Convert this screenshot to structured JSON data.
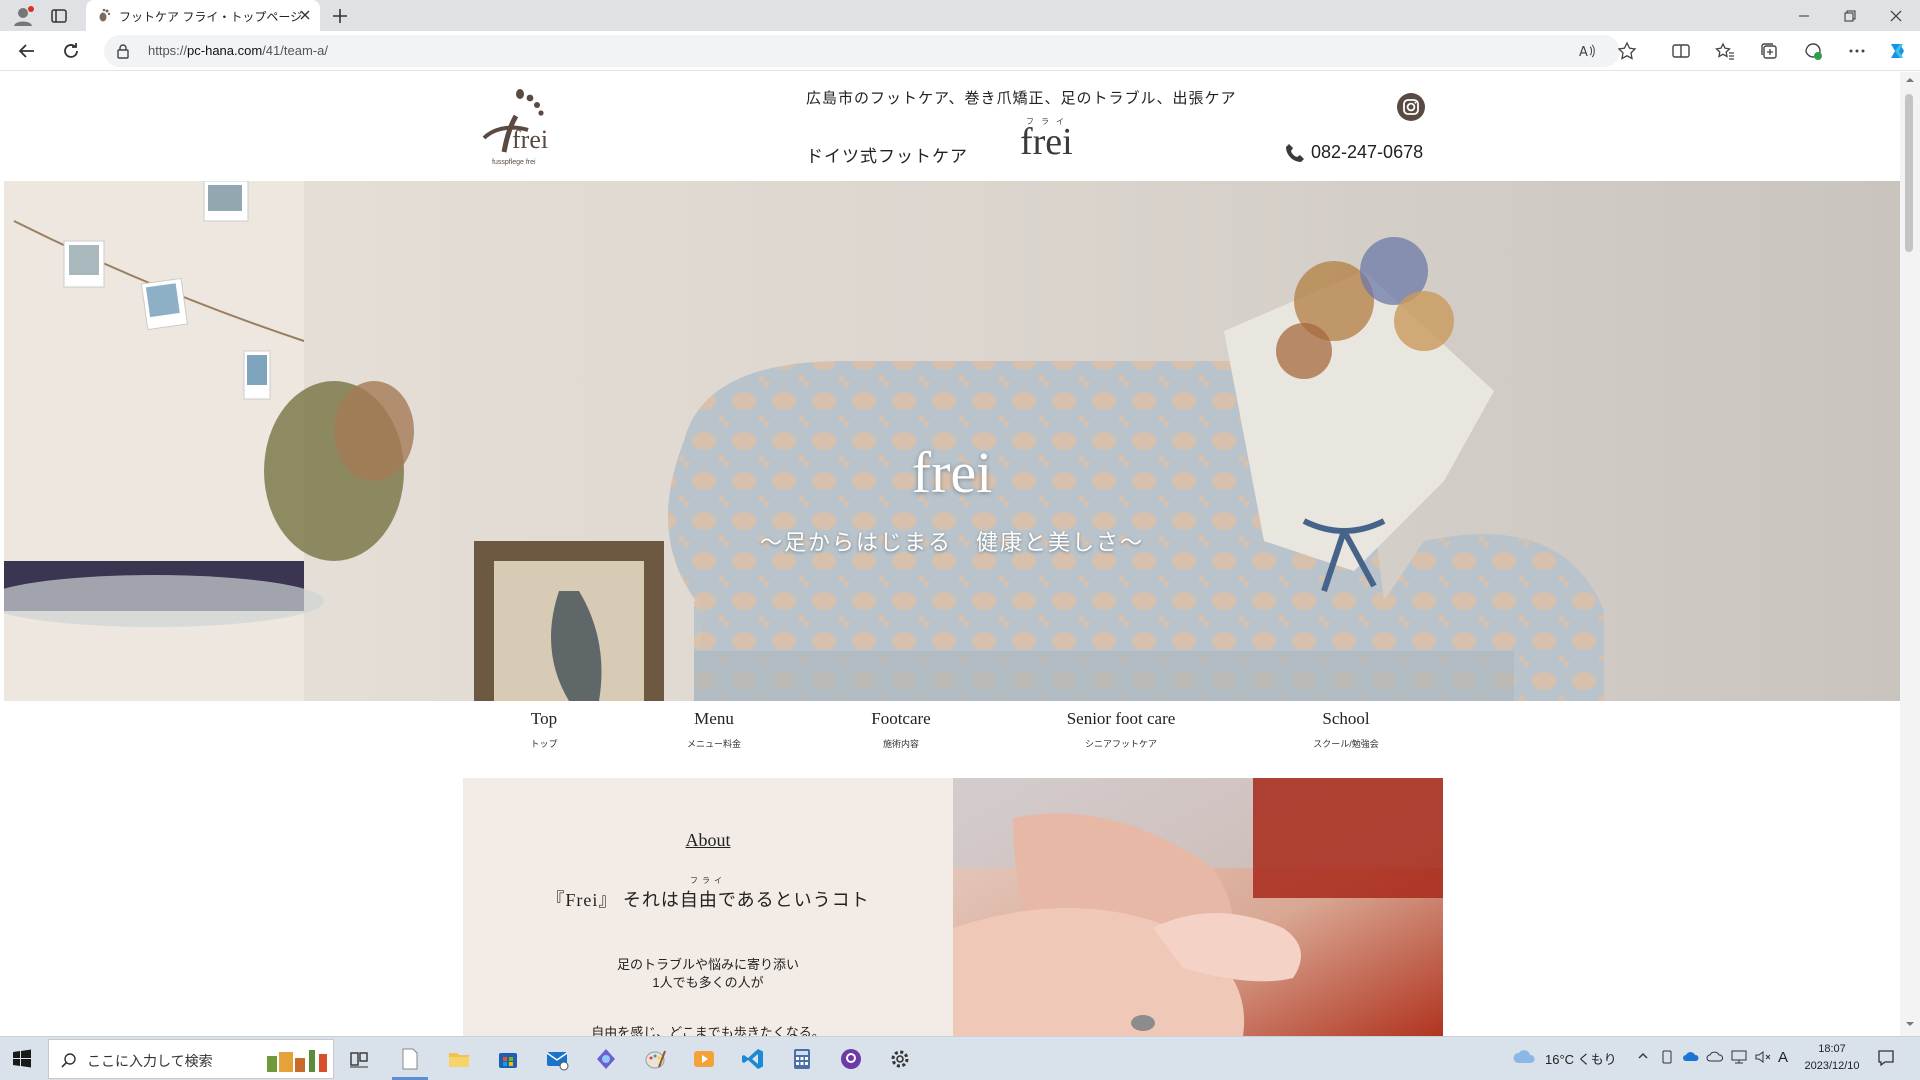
{
  "browser": {
    "tab_title": "フットケア フライ・トップページ",
    "url_prefix": "https://",
    "url_host": "pc-hana.com",
    "url_path": "/41/team-a/"
  },
  "header": {
    "logo_text": "frei",
    "logo_caption": "fusspflege frei",
    "tagline": "広島市のフットケア、巻き爪矯正、足のトラブル、出張ケア",
    "subtitle": "ドイツ式フットケア",
    "brand": "frei",
    "brand_ruby": "フライ",
    "phone": "082-247-0678"
  },
  "hero": {
    "title": "frei",
    "subtitle": "〜足からはじまる　健康と美しさ〜"
  },
  "nav": [
    {
      "en": "Top",
      "jp": "トップ"
    },
    {
      "en": "Menu",
      "jp": "メニュー料金"
    },
    {
      "en": "Footcare",
      "jp": "施術内容"
    },
    {
      "en": "Senior foot care",
      "jp": "シニアフットケア"
    },
    {
      "en": "School",
      "jp": "スクール/勉強会"
    }
  ],
  "about": {
    "heading": "About",
    "ruby": "フライ",
    "lead": "『Frei』 それは自由であるというコト",
    "line1": "足のトラブルや悩みに寄り添い",
    "line2": "1人でも多くの人が",
    "line3": "自由を感じ、どこまでも歩きたくなる。"
  },
  "taskbar": {
    "search_placeholder": "ここに入力して検索",
    "weather": "16°C くもり",
    "ime": "A",
    "time": "18:07",
    "date": "2023/12/10"
  },
  "colors": {
    "accent": "#5a4a42",
    "about_bg": "#f3ece6",
    "taskbar_bg": "#d9e1ea"
  }
}
